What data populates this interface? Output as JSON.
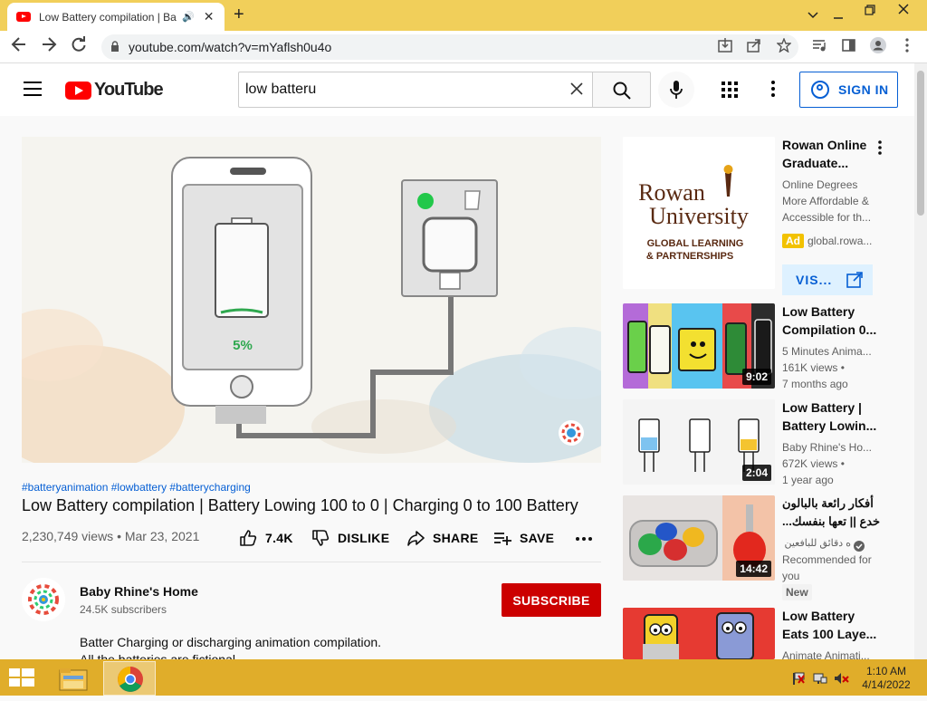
{
  "browser": {
    "tab_title": "Low Battery compilation | Ba",
    "url": "youtube.com/watch?v=mYaflsh0u4o",
    "icons": [
      "back-arrow-icon",
      "forward-arrow-icon",
      "reload-icon",
      "lock-icon",
      "install-icon",
      "share-icon",
      "star-icon",
      "media-icon",
      "sidepanel-icon",
      "profile-icon",
      "menu-kebab-icon"
    ]
  },
  "youtube": {
    "logo_text": "YouTube",
    "search_value": "low batteru",
    "signin_label": "SIGN IN"
  },
  "video": {
    "hashtags": "#batteryanimation #lowbattery #batterycharging",
    "title": "Low Battery compilation | Battery Lowing 100 to 0 | Charging 0 to 100 Battery",
    "meta": "2,230,749 views • Mar 23, 2021",
    "player_battery_text": "5%",
    "actions": {
      "like": "7.4K",
      "dislike": "DISLIKE",
      "share": "SHARE",
      "save": "SAVE"
    },
    "channel": {
      "name": "Baby Rhine's Home",
      "subscribers": "24.5K subscribers"
    },
    "subscribe_label": "SUBSCRIBE",
    "description": [
      "Batter Charging or discharging animation compilation.",
      "All the batteries are fictional"
    ]
  },
  "sidebar": {
    "ad": {
      "logo_line1": "Rowan",
      "logo_line2": "University",
      "logo_sub1": "GLOBAL LEARNING",
      "logo_sub2": "& PARTNERSHIPS",
      "title_line1": "Rowan Online",
      "title_line2": "Graduate...",
      "desc_line1": "Online Degrees",
      "desc_line2": "More Affordable &",
      "desc_line3": "Accessible for th...",
      "badge": "Ad",
      "domain": "global.rowa...",
      "visit_label": "VIS..."
    },
    "items": [
      {
        "title_line1": "Low Battery",
        "title_line2": "Compilation 0...",
        "channel": "5 Minutes Anima...",
        "views": "161K views •",
        "age": "7 months ago",
        "duration": "9:02"
      },
      {
        "title_line1": "Low Battery |",
        "title_line2": "Battery Lowin...",
        "channel": "Baby Rhine's Ho...",
        "views": "672K views •",
        "age": "1 year ago",
        "duration": "2:04"
      },
      {
        "title_line1": "أفكار رائعة بالبالون",
        "title_line2": "خدع || تعها بنفسك...",
        "channel": "ه دقائق للبافعين ...",
        "views": "Recommended for",
        "age": "you",
        "badge": "New",
        "duration": "14:42"
      },
      {
        "title_line1": "Low Battery",
        "title_line2": "Eats 100 Laye...",
        "channel": "Animate Animati..."
      }
    ]
  },
  "taskbar": {
    "time": "1:10 AM",
    "date": "4/14/2022"
  }
}
